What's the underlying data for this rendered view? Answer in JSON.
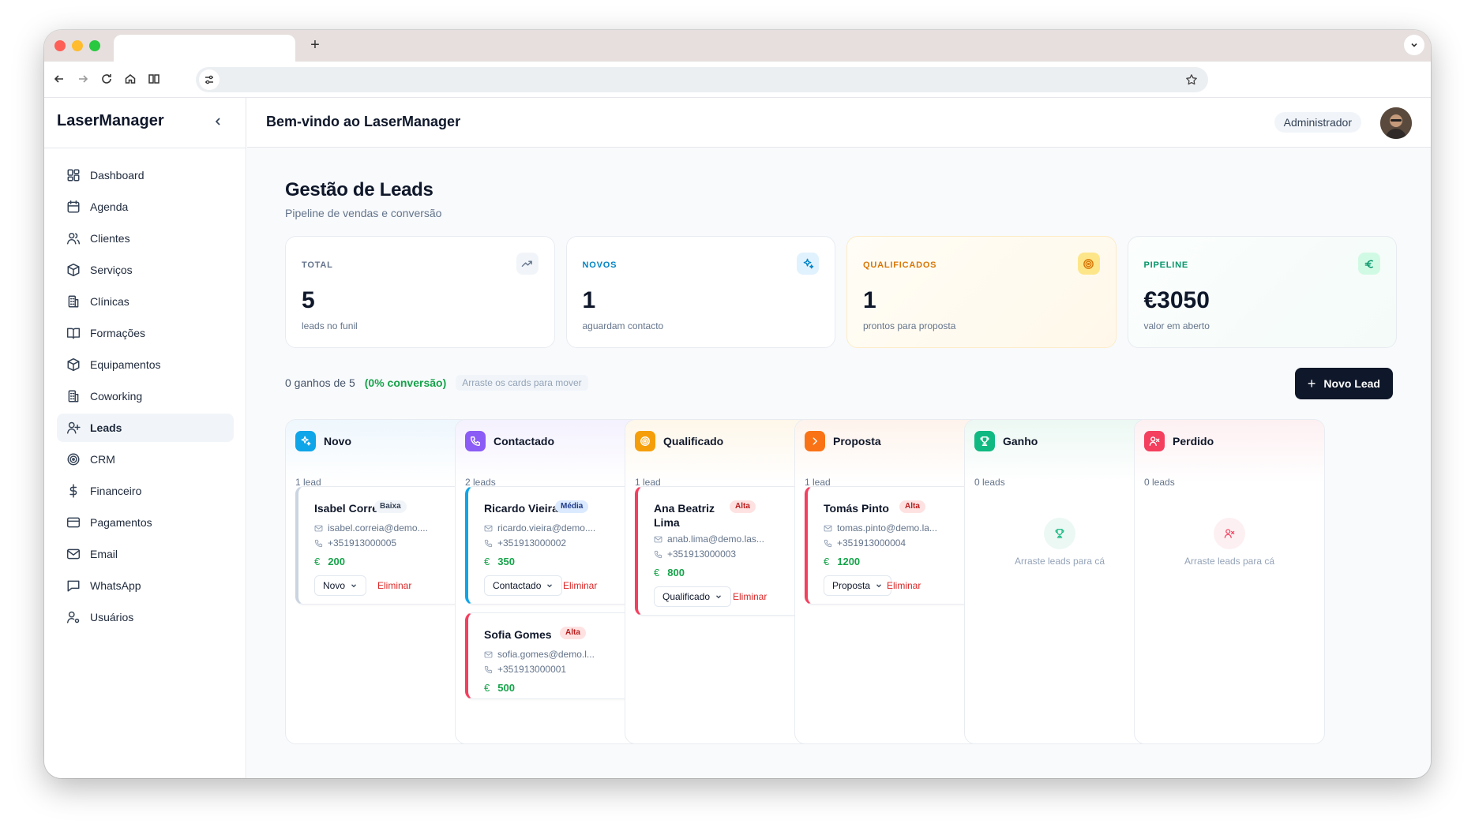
{
  "app": {
    "brand": "LaserManager",
    "welcome": "Bem-vindo ao LaserManager",
    "role": "Administrador"
  },
  "sidebar": {
    "items": [
      {
        "label": "Dashboard",
        "icon": "dashboard-icon"
      },
      {
        "label": "Agenda",
        "icon": "calendar-icon"
      },
      {
        "label": "Clientes",
        "icon": "users-icon"
      },
      {
        "label": "Serviços",
        "icon": "package-icon"
      },
      {
        "label": "Clínicas",
        "icon": "building-icon"
      },
      {
        "label": "Formações",
        "icon": "book-icon"
      },
      {
        "label": "Equipamentos",
        "icon": "package-icon"
      },
      {
        "label": "Coworking",
        "icon": "building-icon"
      },
      {
        "label": "Leads",
        "icon": "user-plus-icon",
        "active": true
      },
      {
        "label": "CRM",
        "icon": "target-icon"
      },
      {
        "label": "Financeiro",
        "icon": "dollar-icon"
      },
      {
        "label": "Pagamentos",
        "icon": "credit-card-icon"
      },
      {
        "label": "Email",
        "icon": "mail-icon"
      },
      {
        "label": "WhatsApp",
        "icon": "chat-icon"
      },
      {
        "label": "Usuários",
        "icon": "user-cog-icon"
      }
    ]
  },
  "page": {
    "title": "Gestão de Leads",
    "subtitle": "Pipeline de vendas e conversão"
  },
  "stats": [
    {
      "label": "TOTAL",
      "value": "5",
      "desc": "leads no funil",
      "color": "#64748b",
      "icon": "trending-up-icon"
    },
    {
      "label": "NOVOS",
      "value": "1",
      "desc": "aguardam contacto",
      "color": "#0284c7",
      "icon": "sparkles-icon"
    },
    {
      "label": "QUALIFICADOS",
      "value": "1",
      "desc": "prontos para proposta",
      "color": "#d97706",
      "icon": "target-icon"
    },
    {
      "label": "PIPELINE",
      "value": "€3050",
      "desc": "valor em aberto",
      "color": "#059669",
      "icon": "euro-icon"
    }
  ],
  "summary": {
    "won": "0 ganhos de 5",
    "conversion": "(0% conversão)",
    "hint": "Arraste os cards para mover"
  },
  "actions": {
    "new_lead": "Novo Lead"
  },
  "card_labels": {
    "delete": "Eliminar"
  },
  "columns": [
    {
      "title": "Novo",
      "count": "1 lead",
      "color": "#0ea5e9",
      "icon": "sparkles-icon",
      "leads": [
        {
          "name": "Isabel Correia",
          "priority": "Baixa",
          "email": "isabel.correia@demo....",
          "phone": "+351913000005",
          "value": "200",
          "status": "Novo"
        }
      ]
    },
    {
      "title": "Contactado",
      "count": "2 leads",
      "color": "#8b5cf6",
      "icon": "phone-icon",
      "leads": [
        {
          "name": "Ricardo Vieira",
          "priority": "Média",
          "email": "ricardo.vieira@demo....",
          "phone": "+351913000002",
          "value": "350",
          "status": "Contactado"
        },
        {
          "name": "Sofia Gomes",
          "priority": "Alta",
          "email": "sofia.gomes@demo.l...",
          "phone": "+351913000001",
          "value": "500"
        }
      ]
    },
    {
      "title": "Qualificado",
      "count": "1 lead",
      "color": "#f59e0b",
      "icon": "target-icon",
      "leads": [
        {
          "name": "Ana Beatriz Lima",
          "priority": "Alta",
          "email": "anab.lima@demo.las...",
          "phone": "+351913000003",
          "value": "800",
          "status": "Qualificado"
        }
      ]
    },
    {
      "title": "Proposta",
      "count": "1 lead",
      "color": "#f97316",
      "icon": "chevron-right-icon",
      "leads": [
        {
          "name": "Tomás Pinto",
          "priority": "Alta",
          "email": "tomas.pinto@demo.la...",
          "phone": "+351913000004",
          "value": "1200",
          "status": "Proposta"
        }
      ]
    },
    {
      "title": "Ganho",
      "count": "0 leads",
      "color": "#10b981",
      "icon": "trophy-icon",
      "empty": "Arraste leads para cá"
    },
    {
      "title": "Perdido",
      "count": "0 leads",
      "color": "#f43f5e",
      "icon": "user-x-icon",
      "empty": "Arraste leads para cá"
    }
  ]
}
